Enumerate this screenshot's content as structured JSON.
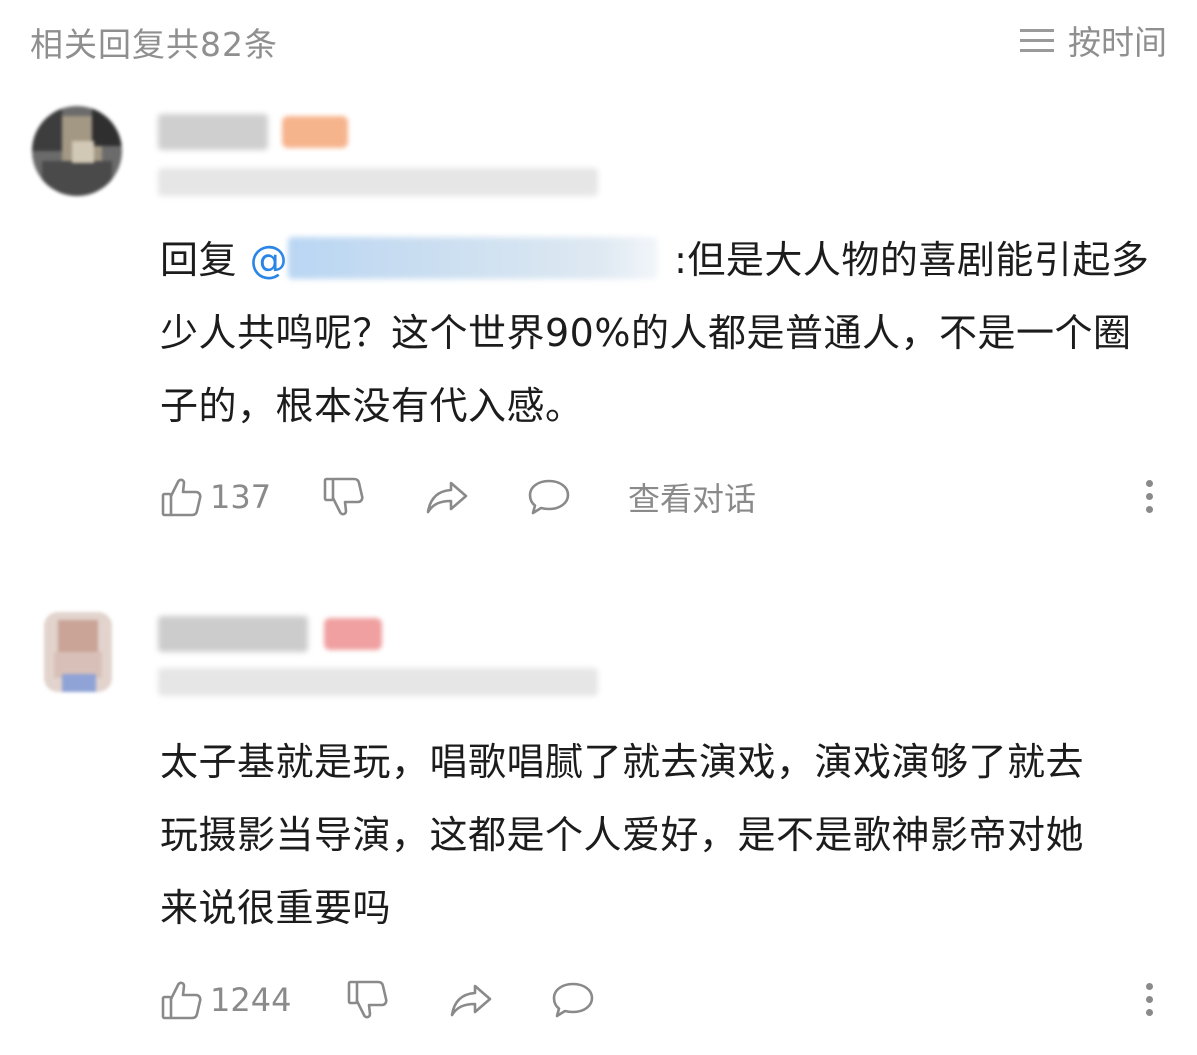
{
  "header": {
    "title": "相关回复共82条",
    "sort_label": "按时间",
    "sort_icon": "menu-lines-icon"
  },
  "comments": [
    {
      "reply_prefix": "回复",
      "mention_at": "@",
      "text_after_mention": ":但是大人物的喜剧能引起多少人共鸣呢？这个世界90%的人都是普通人，不是一个圈子的，根本没有代入感。",
      "likes": "137",
      "view_conversation": "查看对话",
      "badge_color": "#f6b48d"
    },
    {
      "text": "太子基就是玩，唱歌唱腻了就去演戏，演戏演够了就去玩摄影当导演，这都是个人爱好，是不是歌神影帝对她来说很重要吗",
      "likes": "1244",
      "badge_color": "#f0a0a0"
    }
  ],
  "colors": {
    "muted": "#8a8a8a",
    "mention": "#2a86e6",
    "text": "#1c1c1c"
  }
}
